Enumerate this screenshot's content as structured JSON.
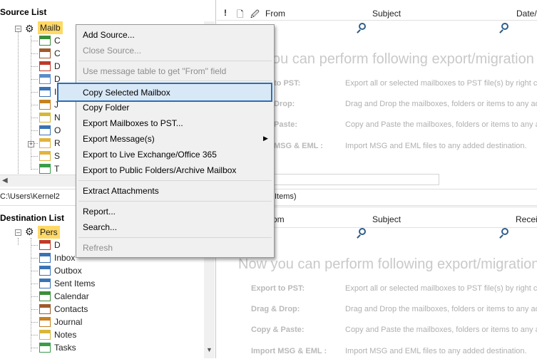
{
  "source_panel": {
    "title": "Source List",
    "root_label": "Mailb",
    "path_text": "C:\\Users\\Kernel2",
    "items": [
      {
        "label": "C",
        "icon": "calendar-icon"
      },
      {
        "label": "C",
        "icon": "contacts-icon"
      },
      {
        "label": "D",
        "icon": "deleted-items-icon"
      },
      {
        "label": "D",
        "icon": "drafts-icon"
      },
      {
        "label": "I",
        "icon": "inbox-icon"
      },
      {
        "label": "J",
        "icon": "journal-icon"
      },
      {
        "label": "N",
        "icon": "notes-icon"
      },
      {
        "label": "O",
        "icon": "outbox-icon"
      },
      {
        "label": "R",
        "icon": "folder-icon"
      },
      {
        "label": "S",
        "icon": "folder-icon"
      },
      {
        "label": "T",
        "icon": "tasks-icon"
      }
    ]
  },
  "destination_panel": {
    "title": "Destination List",
    "root_label": "Pers",
    "items": [
      {
        "label": "D",
        "icon": "deleted-items-icon"
      },
      {
        "label": "Inbox",
        "icon": "inbox-icon"
      },
      {
        "label": "Outbox",
        "icon": "outbox-icon"
      },
      {
        "label": "Sent Items",
        "icon": "sent-items-icon"
      },
      {
        "label": "Calendar",
        "icon": "calendar-icon"
      },
      {
        "label": "Contacts",
        "icon": "contacts-icon"
      },
      {
        "label": "Journal",
        "icon": "journal-icon"
      },
      {
        "label": "Notes",
        "icon": "notes-icon"
      },
      {
        "label": "Tasks",
        "icon": "tasks-icon"
      }
    ]
  },
  "top_grid": {
    "col_importance": "!",
    "col_from": "From",
    "col_subject": "Subject",
    "col_date": "Date/",
    "status_text": "Items)"
  },
  "bottom_grid": {
    "col_from": "om",
    "col_subject": "Subject",
    "col_received": "Receit"
  },
  "top_info": {
    "headline": "ou can perform following export/migration",
    "rows": [
      {
        "label": "to PST:",
        "desc": "Export all or selected mailboxes to PST file(s) by right cl"
      },
      {
        "label": "Drop:",
        "desc": "Drag and Drop the mailboxes, folders or items to any ad"
      },
      {
        "label": "Paste:",
        "desc": "Copy and Paste the mailboxes, folders or items to any ad"
      },
      {
        "label": "MSG & EML :",
        "desc": "Import MSG and EML files to any added destination."
      }
    ]
  },
  "bottom_info": {
    "headline": "Now you can perform following export/migration",
    "rows": [
      {
        "label": "Export to PST:",
        "desc": "Export all or selected mailboxes to PST file(s) by right cl"
      },
      {
        "label": "Drag & Drop:",
        "desc": "Drag and Drop the mailboxes, folders or items to any ad"
      },
      {
        "label": "Copy & Paste:",
        "desc": "Copy and Paste the mailboxes, folders or items to any ad"
      },
      {
        "label": "Import MSG & EML :",
        "desc": "Import MSG and EML files to any added destination."
      }
    ]
  },
  "context_menu": {
    "add_source": "Add Source...",
    "close_source": "Close Source...",
    "use_message_table": "Use message table to get \"From\" field",
    "copy_selected_mailbox": "Copy Selected Mailbox",
    "copy_folder": "Copy Folder",
    "export_mailboxes_pst": "Export Mailboxes to PST...",
    "export_messages": "Export Message(s)",
    "export_live_exchange": "Export to Live Exchange/Office 365",
    "export_public_folders": "Export to Public Folders/Archive Mailbox",
    "extract_attachments": "Extract Attachments",
    "report": "Report...",
    "search": "Search...",
    "refresh": "Refresh"
  },
  "colors": {
    "menu_highlight_border": "#2a6fb3",
    "menu_highlight_fill": "#d9e8f7",
    "selection": "#ffd966"
  }
}
